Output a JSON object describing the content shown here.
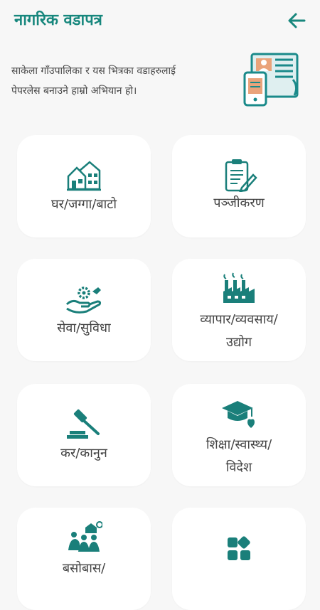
{
  "header": {
    "title": "नागरिक वडापत्र",
    "back_icon": "arrow-left-icon",
    "accent": "#17877d"
  },
  "intro": {
    "line1": "साकेला गाँउपालिका र यस भित्रका वडाहरुलाई",
    "line2": "पेपरलेस बनाउने हाम्रो अभियान हो।",
    "image_icon": "phone-newspaper-icon"
  },
  "cards": [
    {
      "icon": "houses-icon",
      "lines": [
        "घर/जग्गा/बाटो"
      ]
    },
    {
      "icon": "clipboard-pen-icon",
      "lines": [
        "पञ्जीकरण"
      ]
    },
    {
      "icon": "hand-gear-icon",
      "lines": [
        "सेवा/सुविधा"
      ]
    },
    {
      "icon": "factory-icon",
      "lines": [
        "व्यापार/व्यवसाय/",
        "उद्योग"
      ]
    },
    {
      "icon": "gavel-icon",
      "lines": [
        "कर/कानुन"
      ]
    },
    {
      "icon": "graduation-heart-icon",
      "lines": [
        "शिक्षा/स्वास्थ्य/",
        "विदेश"
      ]
    },
    {
      "icon": "settlement-people-icon",
      "lines": [
        "बसोबास/"
      ]
    },
    {
      "icon": "apps-grid-icon",
      "lines": [
        ""
      ]
    }
  ]
}
